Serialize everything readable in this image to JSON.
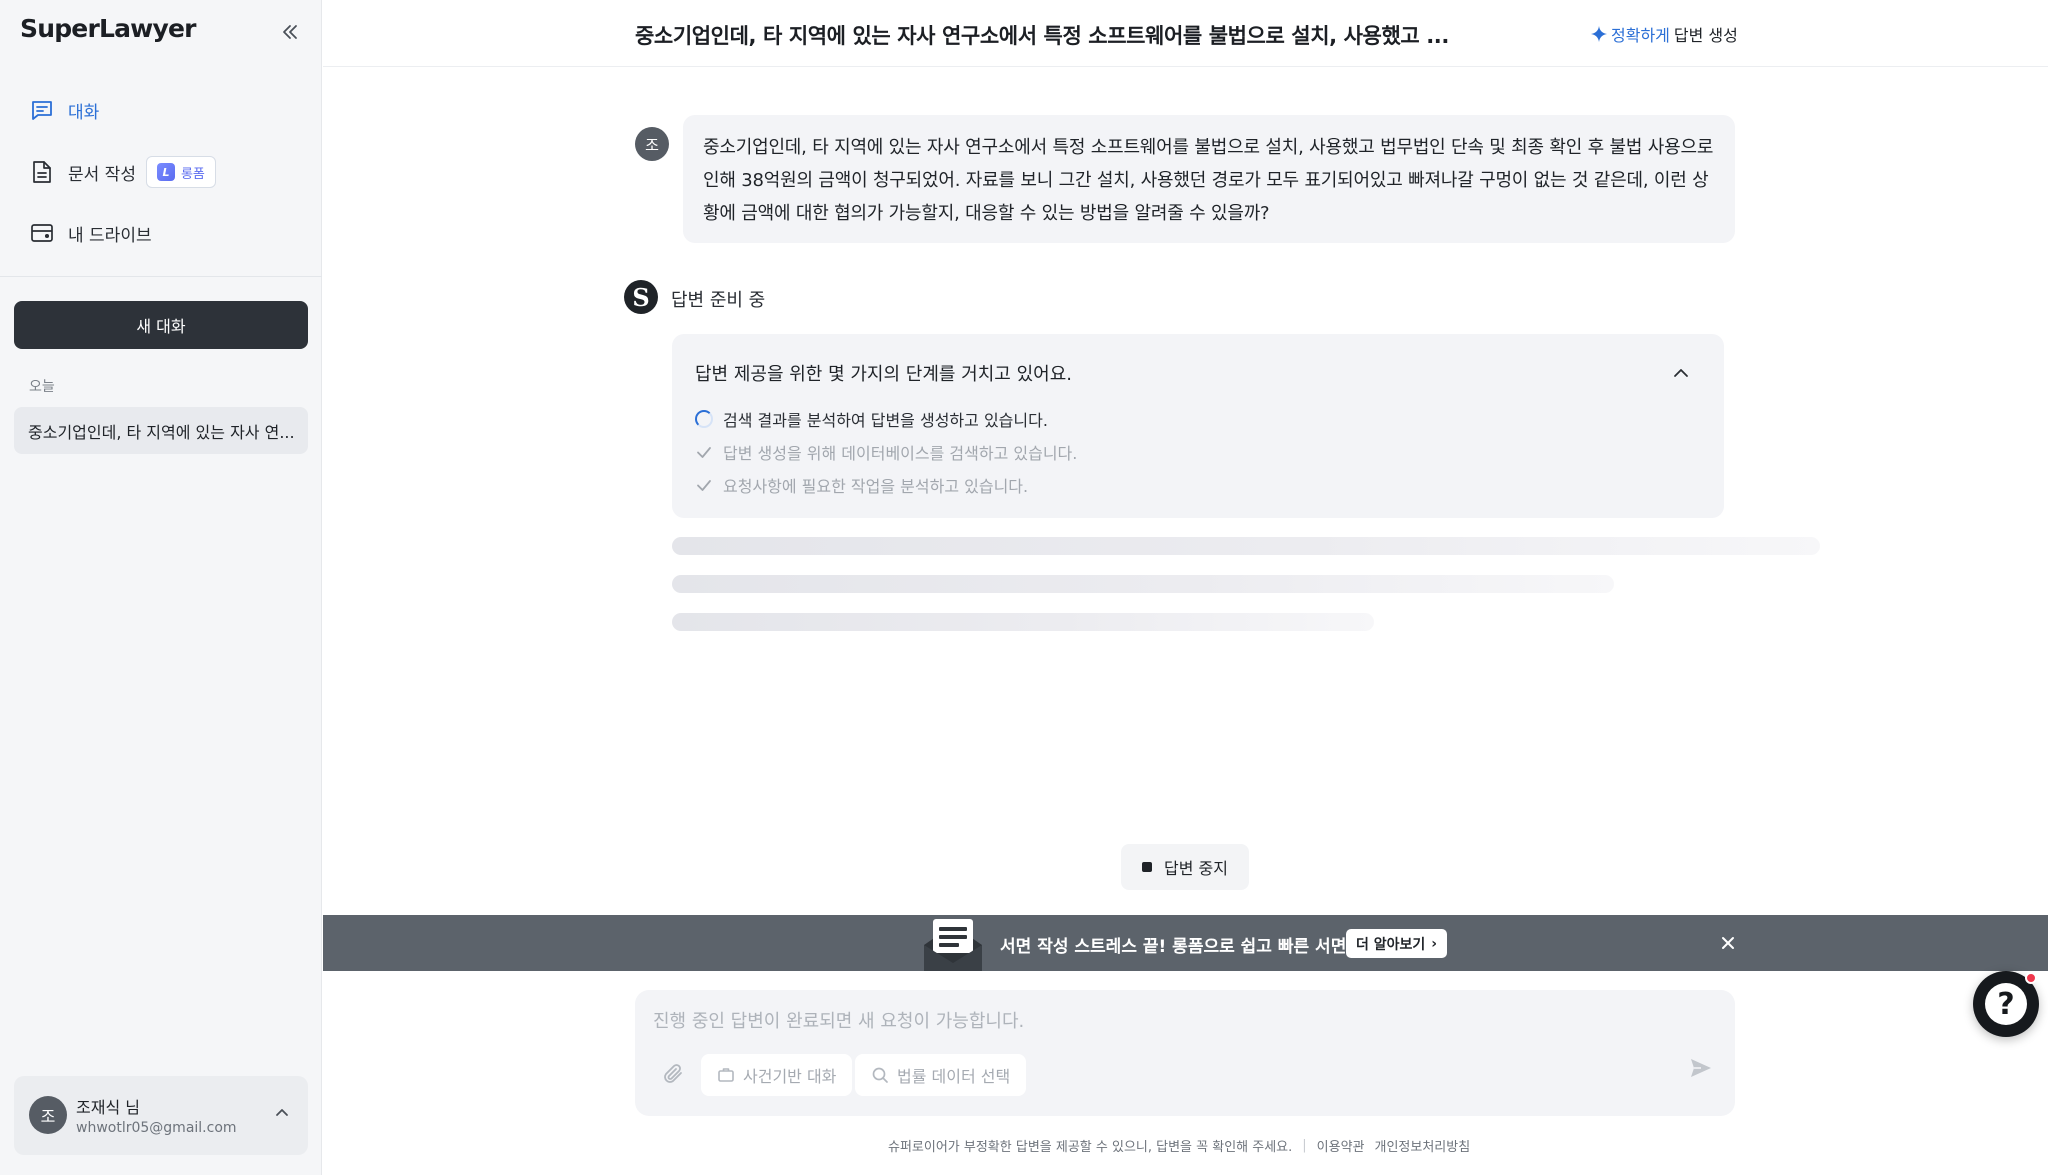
{
  "sidebar": {
    "brand": "SuperLawyer",
    "nav": [
      {
        "label": "대화",
        "icon": "chat-icon",
        "active": true
      },
      {
        "label": "문서 작성",
        "icon": "document-icon",
        "badge": "롱폼",
        "badge_icon": "longform-logo-icon"
      },
      {
        "label": "내 드라이브",
        "icon": "drive-icon"
      }
    ],
    "new_chat_label": "새 대화",
    "history_group": "오늘",
    "history": [
      {
        "title": "중소기업인데, 타 지역에 있는 자사 연..."
      }
    ],
    "user": {
      "initial": "조",
      "name": "조재식 님",
      "email": "whwotlr05@gmail.com"
    }
  },
  "header": {
    "title": "중소기업인데, 타 지역에 있는 자사 연구소에서 특정 소프트웨어를 불법으로 설치, 사용했고 ...",
    "action_highlight": "정확하게",
    "action_label": "답변 생성"
  },
  "conversation": {
    "question": {
      "avatar": "조",
      "text": "중소기업인데, 타 지역에 있는 자사 연구소에서 특정 소프트웨어를 불법으로 설치, 사용했고 법무법인 단속 및 최종 확인 후 불법 사용으로 인해 38억원의 금액이 청구되었어. 자료를 보니 그간 설치, 사용했던 경로가 모두 표기되어있고 빠져나갈 구멍이 없는 것 같은데, 이런 상황에 금액에 대한 협의가 가능할지, 대응할 수 있는 방법을 알려줄 수 있을까?"
    },
    "answer": {
      "logo": "S",
      "status": "답변 준비 중",
      "steps_title": "답변 제공을 위한 몇 가지의 단계를 거치고 있어요.",
      "steps": [
        {
          "text": "검색 결과를 분석하여 답변을 생성하고 있습니다.",
          "state": "in-progress"
        },
        {
          "text": "답변 생성을 위해 데이터베이스를 검색하고 있습니다.",
          "state": "done"
        },
        {
          "text": "요청사항에 필요한 작업을 분석하고 있습니다.",
          "state": "done"
        }
      ]
    },
    "stop_label": "답변 중지"
  },
  "banner": {
    "text": "서면 작성 스트레스 끝! 롱폼으로 쉽고 빠른 서면 작성",
    "button_label": "더 알아보기",
    "button_arrow": "›"
  },
  "composer": {
    "placeholder": "진행 중인 답변이 완료되면 새 요청이 가능합니다.",
    "chips": [
      {
        "label": "사건기반 대화",
        "icon": "briefcase-icon"
      },
      {
        "label": "법률 데이터 선택",
        "icon": "search-icon"
      }
    ]
  },
  "footer": {
    "disclaimer": "슈퍼로이어가 부정확한 답변을 제공할 수 있으니, 답변을 꼭 확인해 주세요.",
    "separator": "|",
    "terms": "이용약관",
    "privacy": "개인정보처리방침"
  },
  "help_widget": {
    "glyph": "?"
  },
  "colors": {
    "accent": "#2b6fd6",
    "sidebar_bg": "#f5f6f8",
    "dark_button": "#2d3239",
    "banner_bg": "#5c636b",
    "notification": "#f0384d"
  }
}
